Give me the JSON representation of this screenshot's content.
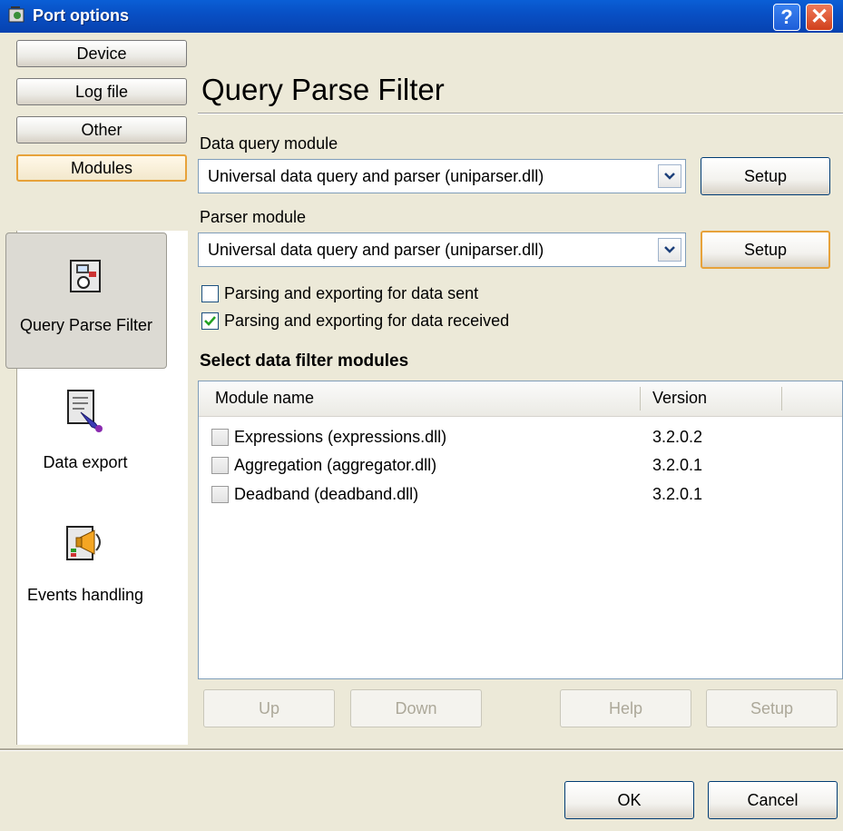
{
  "window": {
    "title": "Port options",
    "help_glyph": "?",
    "close_glyph": "✕"
  },
  "nav": {
    "tabs": [
      {
        "label": "Device"
      },
      {
        "label": "Log file"
      },
      {
        "label": "Other"
      },
      {
        "label": "Modules"
      }
    ],
    "modules": [
      {
        "label": "Query Parse Filter",
        "icon": "query-parse-filter-icon"
      },
      {
        "label": "Data export",
        "icon": "data-export-icon"
      },
      {
        "label": "Events handling",
        "icon": "events-handling-icon"
      }
    ]
  },
  "main": {
    "heading": "Query Parse Filter",
    "query_label": "Data query module",
    "query_value": "Universal data query and parser (uniparser.dll)",
    "parser_label": "Parser module",
    "parser_value": "Universal data query and parser (uniparser.dll)",
    "setup_label": "Setup",
    "chk_sent": "Parsing and exporting for data sent",
    "chk_received": "Parsing and exporting for data received",
    "filter_title": "Select data filter modules",
    "columns": [
      "Module name",
      "Version"
    ],
    "filters": [
      {
        "name": "Expressions (expressions.dll)",
        "version": "3.2.0.2"
      },
      {
        "name": "Aggregation (aggregator.dll)",
        "version": "3.2.0.1"
      },
      {
        "name": "Deadband (deadband.dll)",
        "version": "3.2.0.1"
      }
    ],
    "buttons": {
      "up": "Up",
      "down": "Down",
      "help": "Help",
      "setup": "Setup"
    }
  },
  "footer": {
    "ok": "OK",
    "cancel": "Cancel"
  },
  "colors": {
    "titlebar": "#0850c5",
    "accent_hot": "#e7a23a",
    "dialog_bg": "#ece9d8"
  }
}
